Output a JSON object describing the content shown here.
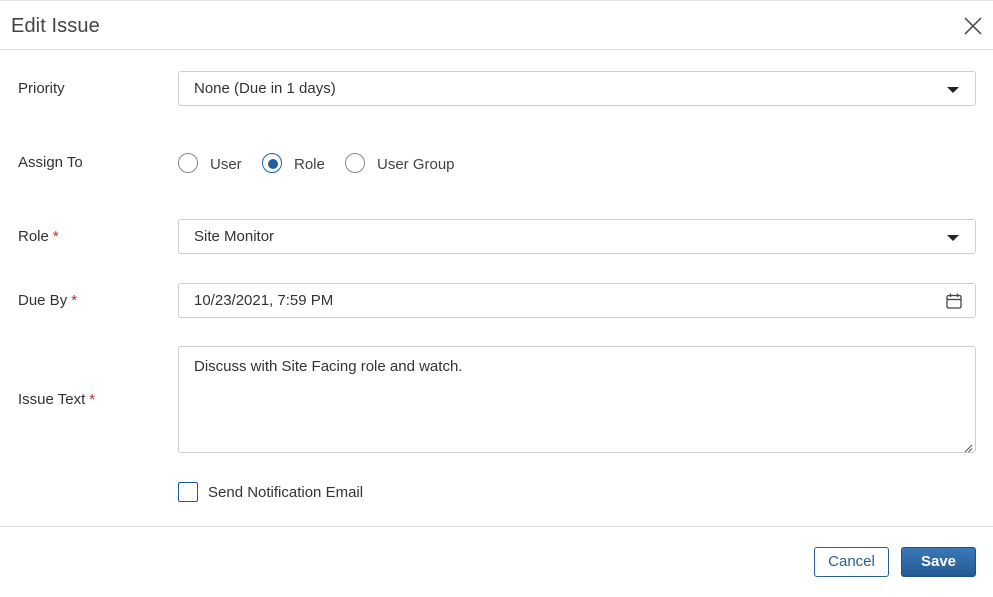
{
  "dialog": {
    "title": "Edit Issue"
  },
  "fields": {
    "priority": {
      "label": "Priority",
      "value": "None (Due in 1 days)"
    },
    "assign_to": {
      "label": "Assign To",
      "options": [
        "User",
        "Role",
        "User Group"
      ],
      "selected": "Role"
    },
    "role": {
      "label": "Role",
      "required_mark": "*",
      "value": "Site Monitor"
    },
    "due_by": {
      "label": "Due By",
      "required_mark": "*",
      "value": "10/23/2021, 7:59 PM"
    },
    "issue_text": {
      "label": "Issue Text",
      "required_mark": "*",
      "value": "Discuss with Site Facing role and watch."
    },
    "send_notification": {
      "label": "Send Notification Email",
      "checked": false
    }
  },
  "footer": {
    "cancel_label": "Cancel",
    "save_label": "Save"
  },
  "colors": {
    "accent": "#1f5fa0",
    "required": "#c62828",
    "save_button": "#2d67a6"
  },
  "icons": {
    "close": "close-icon",
    "dropdown": "caret-down-icon",
    "calendar": "calendar-icon",
    "resize": "resize-grip-icon"
  }
}
